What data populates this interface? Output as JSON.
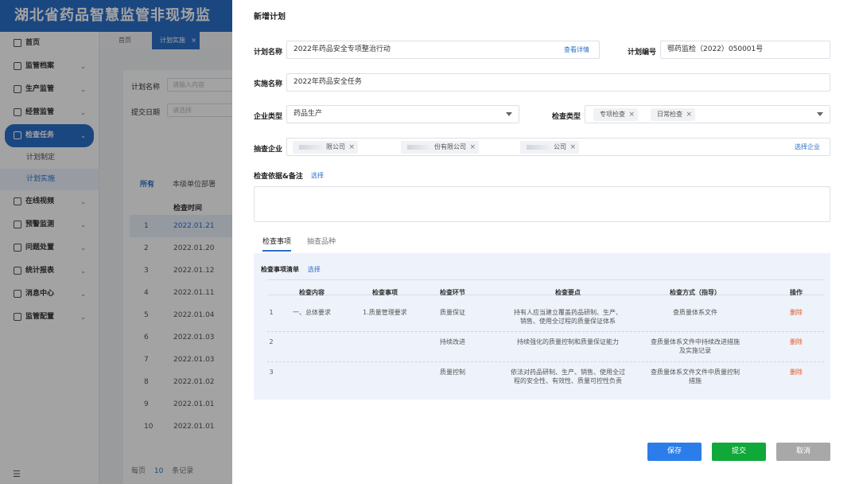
{
  "app": {
    "title": "湖北省药品智慧监管非现场监"
  },
  "sidebar": {
    "items": [
      {
        "label": "首页",
        "icon": "home-icon"
      },
      {
        "label": "监管档案",
        "icon": "archive-icon"
      },
      {
        "label": "生产监管",
        "icon": "factory-icon"
      },
      {
        "label": "经营监管",
        "icon": "shop-icon"
      },
      {
        "label": "检查任务",
        "icon": "task-icon"
      },
      {
        "label": "在线视频",
        "icon": "video-icon"
      },
      {
        "label": "预警监测",
        "icon": "warning-icon"
      },
      {
        "label": "问题处置",
        "icon": "edit-icon"
      },
      {
        "label": "统计报表",
        "icon": "report-icon"
      },
      {
        "label": "消息中心",
        "icon": "message-icon"
      },
      {
        "label": "监管配置",
        "icon": "settings-icon"
      }
    ],
    "sub_items": [
      "计划制定",
      "计划实施"
    ],
    "footer_icon": "menu-icon"
  },
  "tabs": {
    "home": "首页",
    "current": "计划实施",
    "close": "×"
  },
  "list": {
    "filter_name_label": "计划名称",
    "filter_name_placeholder": "请输入内容",
    "filter_date_label": "提交日期",
    "filter_date_placeholder": "请选择",
    "tab_all": "所有",
    "tab_local": "本级单位部署",
    "col_date": "检查时间",
    "rows": [
      {
        "idx": "1",
        "date": "2022.01.21"
      },
      {
        "idx": "2",
        "date": "2022.01.20"
      },
      {
        "idx": "3",
        "date": "2022.01.12"
      },
      {
        "idx": "4",
        "date": "2022.01.11"
      },
      {
        "idx": "5",
        "date": "2022.01.04"
      },
      {
        "idx": "6",
        "date": "2022.01.03"
      },
      {
        "idx": "7",
        "date": "2022.01.03"
      },
      {
        "idx": "8",
        "date": "2022.01.02"
      },
      {
        "idx": "9",
        "date": "2022.01.01"
      },
      {
        "idx": "10",
        "date": "2022.01.01"
      }
    ],
    "pager_prefix": "每页",
    "pager_size": "10",
    "pager_suffix": "条记录"
  },
  "drawer": {
    "title": "新增计划",
    "plan_name_label": "计划名称",
    "plan_name_value": "2022年药品安全专项整治行动",
    "view_detail": "查看详情",
    "plan_no_label": "计划编号",
    "plan_no_value": "鄂药监检（2022）050001号",
    "impl_name_label": "实施名称",
    "impl_name_value": "2022年药品安全任务",
    "company_type_label": "企业类型",
    "company_type_value": "药品生产",
    "check_type_label": "检查类型",
    "check_type_tags": [
      "专项检查",
      "日常检查"
    ],
    "sample_company_label": "抽查企业",
    "sample_company_tags": [
      "限公司",
      "份有限公司",
      "公司"
    ],
    "select_company": "选择企业",
    "basis_label": "检查依据&备注",
    "basis_select": "选择",
    "sub_tabs": [
      "检查事项",
      "抽查品种"
    ],
    "list_title": "检查事项清单",
    "list_select": "选择",
    "columns": [
      "检查内容",
      "检查事项",
      "检查环节",
      "检查要点",
      "检查方式（指导）",
      "操作"
    ],
    "rows": [
      {
        "no": "1",
        "content": "一、总体要求",
        "item": "1.质量管理要求",
        "stage": "质量保证",
        "point_l1": "持有人应当建立覆盖药品研制、生产、",
        "point_l2": "销售、使用全过程的质量保证体系",
        "method_l1": "查质量体系文件",
        "method_l2": "",
        "action": "删除"
      },
      {
        "no": "2",
        "content": "",
        "item": "",
        "stage": "持续改进",
        "point_l1": "持续强化的质量控制和质量保证能力",
        "point_l2": "",
        "method_l1": "查质量体系文件中持续改进措施",
        "method_l2": "及实施记录",
        "action": "删除"
      },
      {
        "no": "3",
        "content": "",
        "item": "",
        "stage": "质量控制",
        "point_l1": "依法对药品研制、生产、销售、使用全过",
        "point_l2": "程的安全性、有效性、质量可控性负责",
        "method_l1": "查质量体系文件文件中质量控制",
        "method_l2": "措施",
        "action": "删除"
      }
    ],
    "buttons": {
      "save": "保存",
      "submit": "提交",
      "cancel": "取消"
    },
    "colors": {
      "primary": "#2b7de9",
      "submit": "#11a83a",
      "cancel": "#a8a8a8",
      "delete": "#e05a2b"
    }
  }
}
